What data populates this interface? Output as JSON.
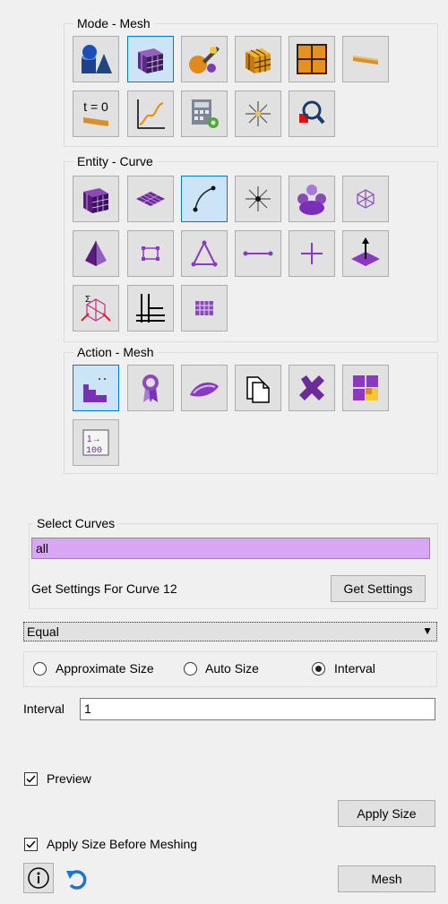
{
  "mode_group": {
    "title": "Mode - Mesh",
    "icons": [
      "geometry-icon",
      "mesh-cube-icon",
      "tools-icon",
      "mesh-grid-icon",
      "mesh-quad-icon",
      "sweep-icon",
      "time-zero-icon",
      "plot-icon",
      "calculator-icon",
      "explode-icon",
      "inspect-icon"
    ]
  },
  "entity_group": {
    "title": "Entity - Curve",
    "icons": [
      "volume-icon",
      "surface-icon",
      "curve-icon",
      "vertex-icon",
      "group-icon",
      "node-icon",
      "tet-icon",
      "quad-icon",
      "tri-icon",
      "edge-icon",
      "point-icon",
      "normal-icon",
      "sideset-icon",
      "hex-icon",
      "grid-icon"
    ]
  },
  "action_group": {
    "title": "Action - Mesh",
    "icons": [
      "interval-icon",
      "ribbon-icon",
      "smooth-icon",
      "copy-icon",
      "delete-icon",
      "block-icon",
      "number-icon"
    ]
  },
  "select_curves": {
    "title": "Select Curves",
    "value": "all",
    "settings_label": "Get Settings For Curve 12",
    "get_settings_button": "Get Settings"
  },
  "scheme_dropdown": {
    "value": "Equal"
  },
  "size_options": {
    "approximate": "Approximate Size",
    "auto": "Auto Size",
    "interval": "Interval",
    "selected": "interval"
  },
  "interval": {
    "label": "Interval",
    "value": "1"
  },
  "preview": {
    "label": "Preview",
    "checked": true
  },
  "apply_size_button": "Apply Size",
  "apply_before_meshing": {
    "label": "Apply Size Before Meshing",
    "checked": true
  },
  "mesh_button": "Mesh",
  "colors": {
    "accent": "#0078d7",
    "selected_input": "#d9a6f5",
    "purple": "#7a2fb8"
  }
}
